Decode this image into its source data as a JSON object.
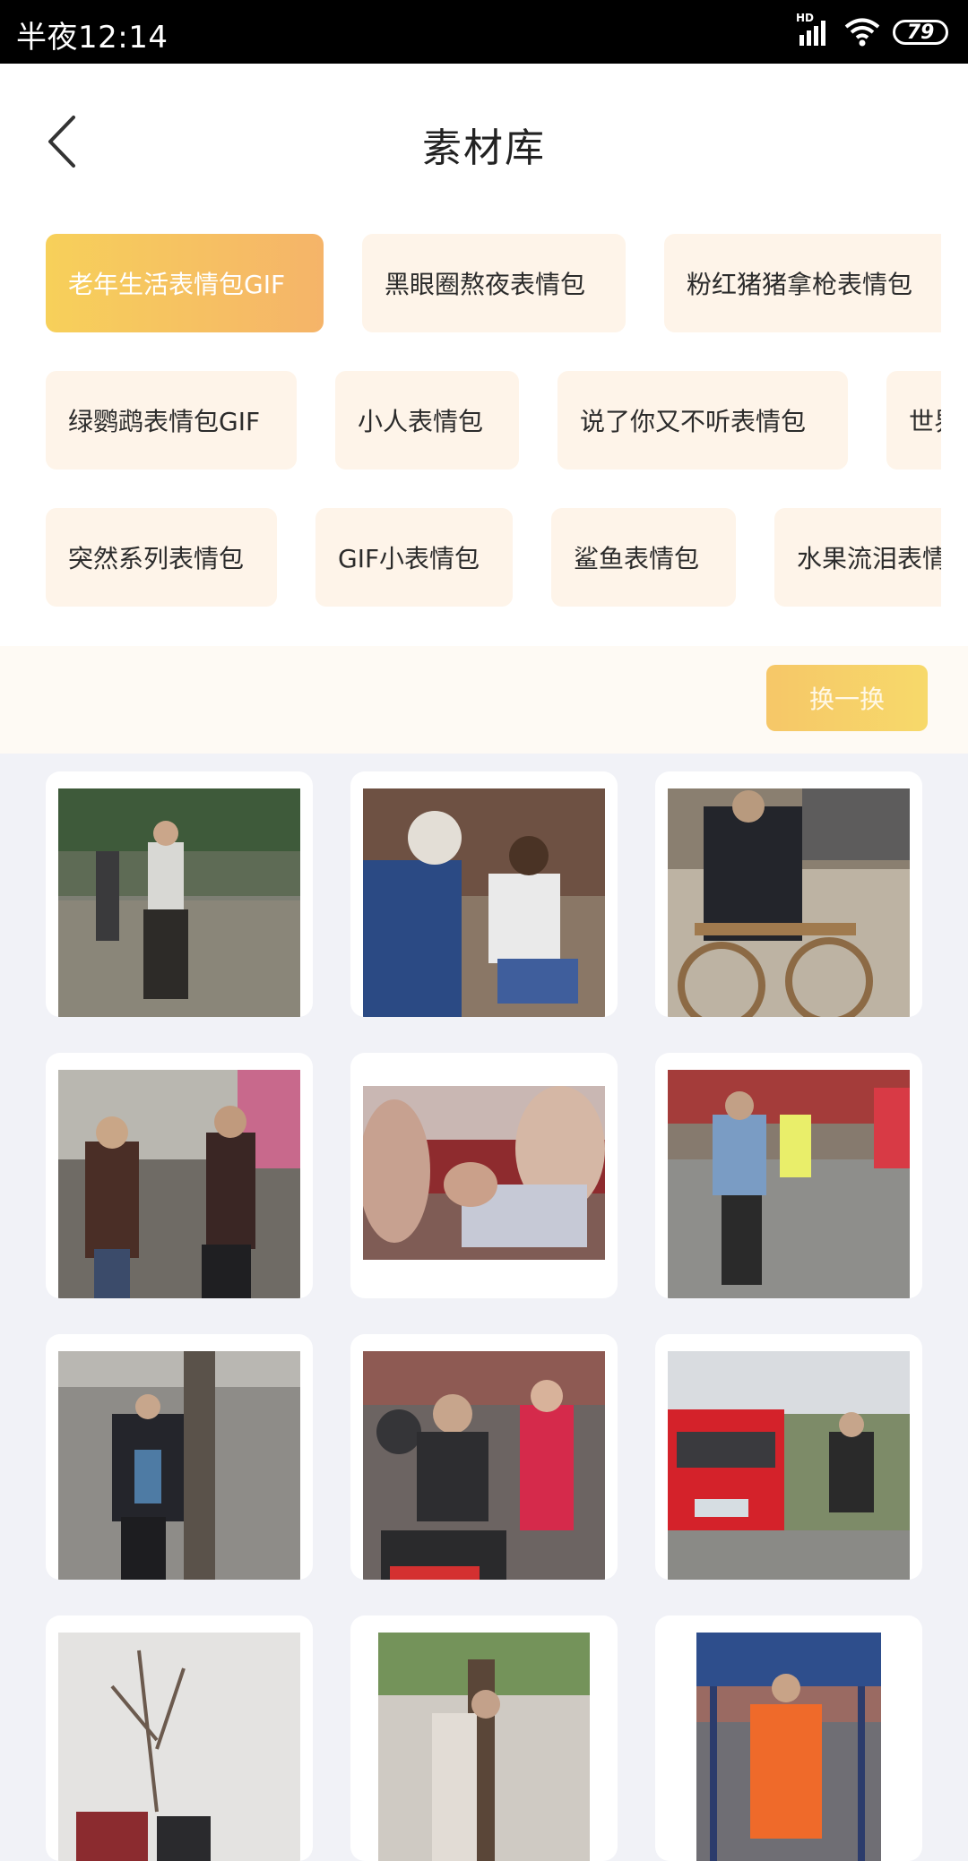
{
  "status_bar": {
    "time": "半夜12:14",
    "network_label": "HD",
    "battery": "79"
  },
  "header": {
    "title": "素材库"
  },
  "tags": {
    "rows": [
      [
        {
          "label": "老年生活表情包GIF",
          "active": true
        },
        {
          "label": "黑眼圈熬夜表情包",
          "active": false
        },
        {
          "label": "粉红猪猪拿枪表情包",
          "active": false
        }
      ],
      [
        {
          "label": "绿鹦鹉表情包GIF",
          "active": false
        },
        {
          "label": "小人表情包",
          "active": false
        },
        {
          "label": "说了你又不听表情包",
          "active": false
        },
        {
          "label": "世界",
          "active": false
        }
      ],
      [
        {
          "label": "突然系列表情包",
          "active": false
        },
        {
          "label": "GIF小表情包",
          "active": false
        },
        {
          "label": "鲨鱼表情包",
          "active": false
        },
        {
          "label": "水果流泪表情包",
          "active": false
        }
      ]
    ]
  },
  "refresh": {
    "label": "换一换"
  },
  "colors": {
    "accent_start": "#f7d05a",
    "accent_end": "#f5b469",
    "tag_bg": "#fef4e9",
    "page_bg": "#f1f2f7"
  },
  "grid": {
    "items": [
      {
        "name": "gif-old-man-dancing-plaza"
      },
      {
        "name": "gif-old-man-handshake"
      },
      {
        "name": "gif-man-wooden-bicycle"
      },
      {
        "name": "gif-two-men-dancing"
      },
      {
        "name": "gif-closeup-arm-wrestle"
      },
      {
        "name": "gif-square-dancing"
      },
      {
        "name": "gif-man-hugging-tree"
      },
      {
        "name": "gif-crowd-street-performance"
      },
      {
        "name": "gif-man-by-red-car"
      },
      {
        "name": "gif-bare-trees"
      },
      {
        "name": "gif-street-scene"
      },
      {
        "name": "gif-man-orange-vest"
      }
    ]
  }
}
